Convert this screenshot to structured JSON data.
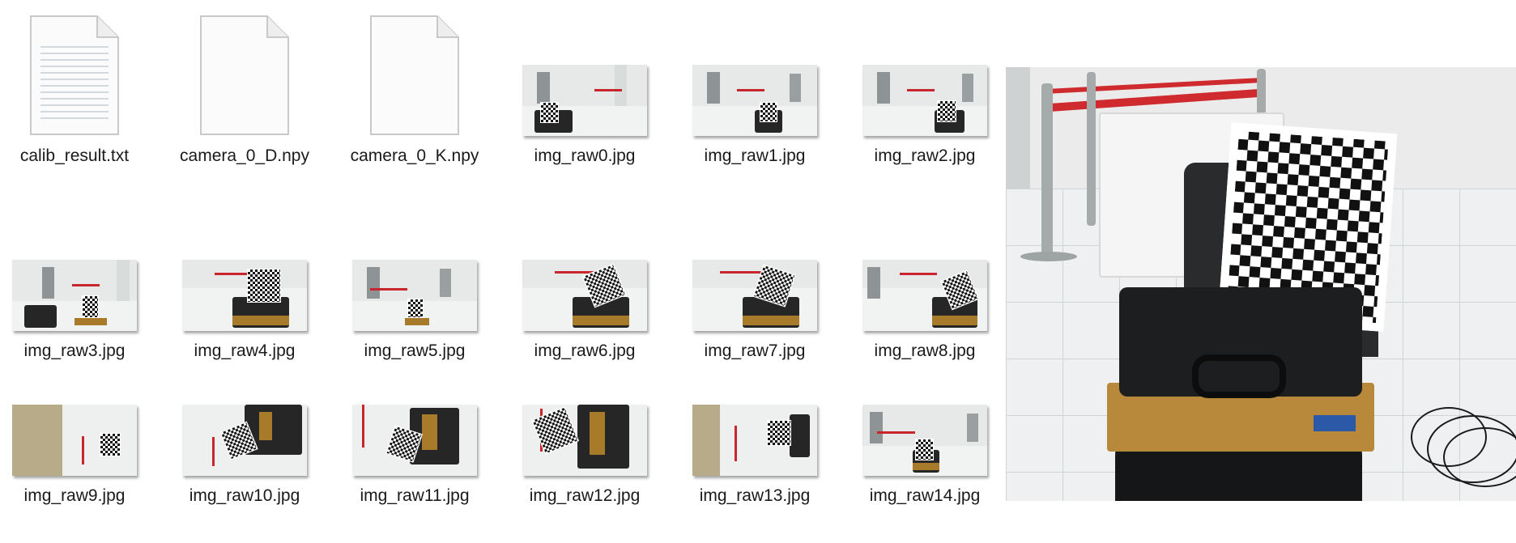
{
  "files": [
    {
      "name": "calib_result.txt",
      "type": "text"
    },
    {
      "name": "camera_0_D.npy",
      "type": "file"
    },
    {
      "name": "camera_0_K.npy",
      "type": "file"
    },
    {
      "name": "img_raw0.jpg",
      "type": "image"
    },
    {
      "name": "img_raw1.jpg",
      "type": "image"
    },
    {
      "name": "img_raw2.jpg",
      "type": "image"
    },
    {
      "name": "img_raw3.jpg",
      "type": "image"
    },
    {
      "name": "img_raw4.jpg",
      "type": "image"
    },
    {
      "name": "img_raw5.jpg",
      "type": "image"
    },
    {
      "name": "img_raw6.jpg",
      "type": "image"
    },
    {
      "name": "img_raw7.jpg",
      "type": "image"
    },
    {
      "name": "img_raw8.jpg",
      "type": "image"
    },
    {
      "name": "img_raw9.jpg",
      "type": "image"
    },
    {
      "name": "img_raw10.jpg",
      "type": "image"
    },
    {
      "name": "img_raw11.jpg",
      "type": "image"
    },
    {
      "name": "img_raw12.jpg",
      "type": "image"
    },
    {
      "name": "img_raw13.jpg",
      "type": "image"
    },
    {
      "name": "img_raw14.jpg",
      "type": "image"
    }
  ]
}
